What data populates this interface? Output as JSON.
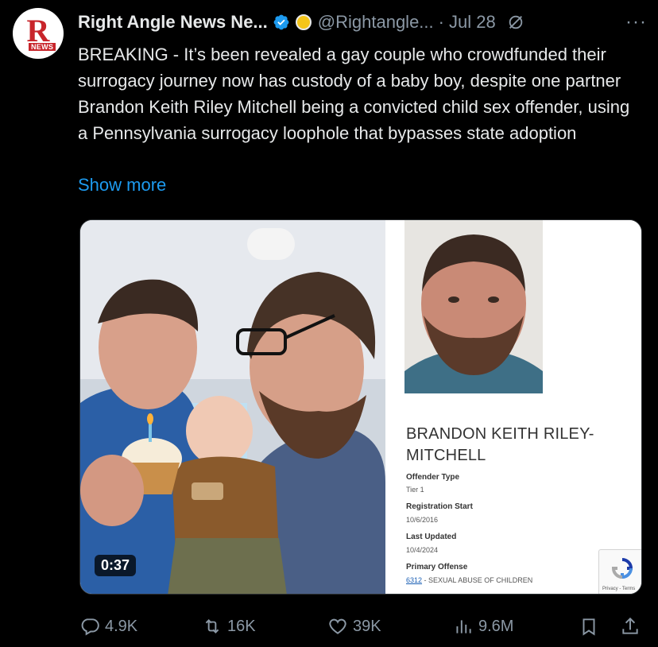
{
  "account": {
    "name": "Right Angle News Ne...",
    "handle": "@Rightangle...",
    "separator": "·",
    "date": "Jul 28",
    "avatar_letter": "R",
    "avatar_sub": "NEWS",
    "verified_icon": "verified-badge-icon",
    "affiliate_icon": "affiliate-badge-icon",
    "more_label": "···"
  },
  "tweet": {
    "text": "BREAKING - It’s been revealed a gay couple who crowdfunded their surrogacy journey now has custody of a baby boy, despite one partner Brandon Keith Riley Mitchell being a convicted child sex offender, using a Pennsylvania surrogacy loophole that bypasses state adoption",
    "show_more": "Show more"
  },
  "media": {
    "video_duration": "0:37",
    "offender_card": {
      "name": "BRANDON KEITH RILEY-MITCHELL",
      "fields": [
        {
          "label": "Offender Type",
          "value": "Tier 1"
        },
        {
          "label": "Registration Start",
          "value": "10/6/2016"
        },
        {
          "label": "Last Updated",
          "value": "10/4/2024"
        },
        {
          "label": "Primary Offense",
          "code": "6312",
          "value": " - SEXUAL ABUSE OF CHILDREN"
        }
      ],
      "recaptcha_text": "Privacy - Terms"
    }
  },
  "actions": {
    "replies": "4.9K",
    "reposts": "16K",
    "likes": "39K",
    "views": "9.6M"
  },
  "colors": {
    "background": "#000000",
    "text": "#e7e9ea",
    "muted": "#8b98a5",
    "link": "#1d9bf0",
    "verified": "#1d9bf0",
    "brand_red": "#c8252b"
  }
}
